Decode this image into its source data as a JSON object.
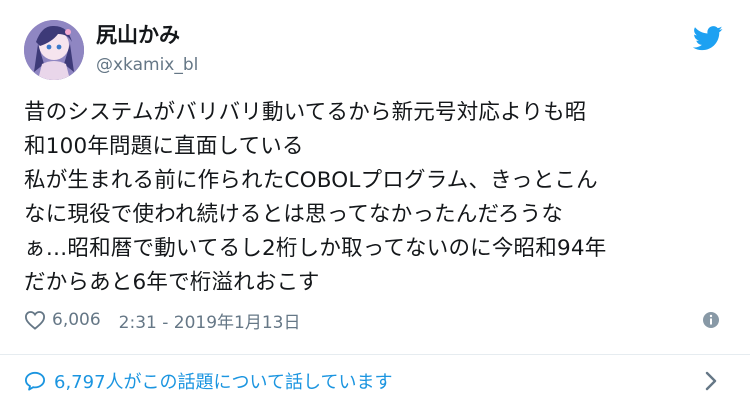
{
  "user": {
    "display_name": "尻山かみ",
    "handle": "@xkamix_bl",
    "avatar_icon": "avatar-image"
  },
  "tweet": {
    "text": "昔のシステムがバリバリ動いてるから新元号対応よりも昭\n和100年問題に直面している\n私が生まれる前に作られたCOBOLプログラム、きっとこん\nなに現役で使われ続けるとは思ってなかったんだろうな\nぁ…昭和暦で動いてるし2桁しか取ってないのに今昭和94年\nだからあと6年で桁溢れおこす"
  },
  "meta": {
    "likes": "6,006",
    "timestamp": "2:31 - 2019年1月13日",
    "heart_icon": "heart-icon",
    "info_icon": "info-icon"
  },
  "conversation": {
    "label": "6,797人がこの話題について話しています",
    "icon": "speech-bubble-icon",
    "chevron_icon": "chevron-right-icon"
  },
  "brand": {
    "icon": "twitter-bird-icon",
    "color": "#1da1f2",
    "link_color": "#1b95e0",
    "muted_color": "#657786"
  }
}
